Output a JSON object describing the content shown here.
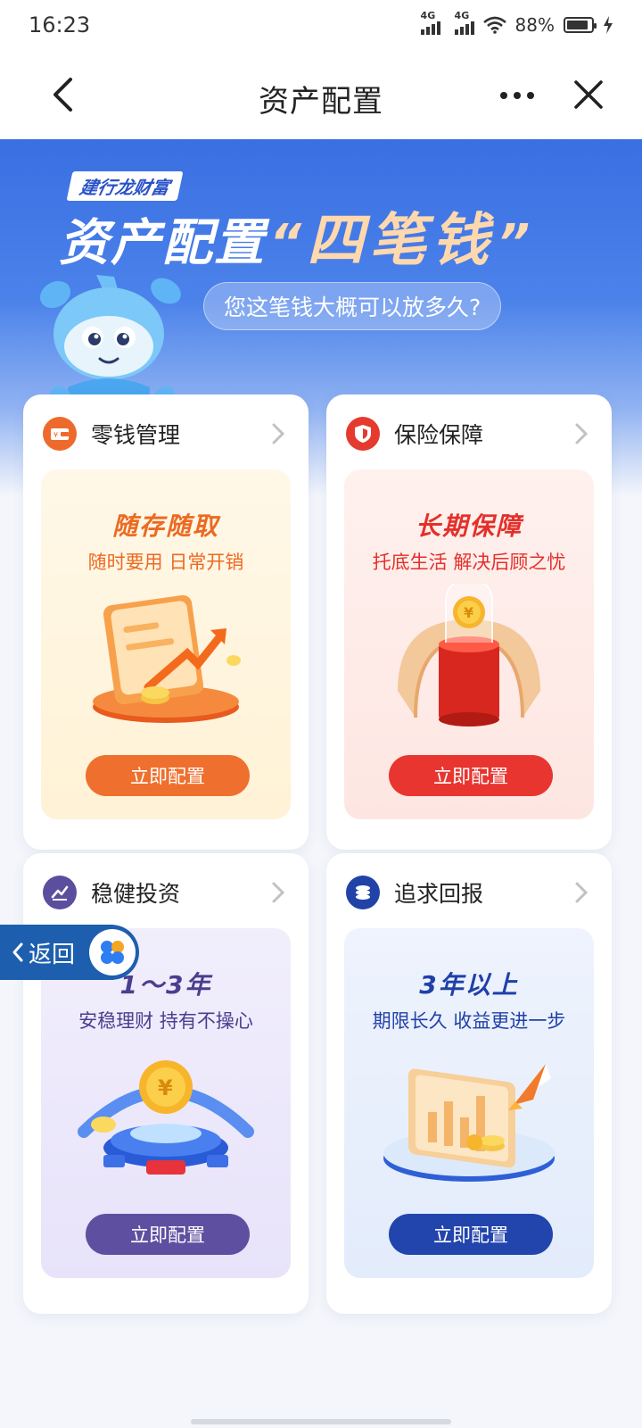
{
  "status_bar": {
    "time": "16:23",
    "signal_1_label": "4G",
    "signal_2_label": "4G",
    "battery_text": "88%",
    "battery_level": 0.88
  },
  "nav": {
    "title": "资产配置"
  },
  "banner": {
    "brand": "建行龙财富",
    "title_main": "资产配置",
    "quote_open": "“",
    "title_highlight": "四笔钱",
    "quote_close": "”",
    "bubble_text": "您这笔钱大概可以放多久?"
  },
  "cards": [
    {
      "label": "零钱管理",
      "heading": "随存随取",
      "subtitle": "随时要用 日常开销",
      "button": "立即配置",
      "icon": "wallet-icon",
      "colors": {
        "accent": "#ee6a2c",
        "heading": "#ec6a22",
        "body_top": "#fff8e8",
        "body_bottom": "#fff2d6",
        "button": "#ef6f2e"
      }
    },
    {
      "label": "保险保障",
      "heading": "长期保障",
      "subtitle": "托底生活 解决后顾之忧",
      "button": "立即配置",
      "icon": "shield-icon",
      "colors": {
        "accent": "#e53a2f",
        "heading": "#e4302a",
        "body_top": "#fff1ee",
        "body_bottom": "#fde6e2",
        "button": "#e8352f"
      }
    },
    {
      "label": "稳健投资",
      "heading": "1～3年",
      "subtitle": "安稳理财 持有不操心",
      "button": "立即配置",
      "icon": "trend-chart-icon",
      "colors": {
        "accent": "#5b4e9e",
        "heading": "#4a3e8e",
        "body_top": "#f1eefc",
        "body_bottom": "#e8e3fa",
        "button": "#5f4fa0"
      }
    },
    {
      "label": "追求回报",
      "heading": "3年以上",
      "subtitle": "期限长久 收益更进一步",
      "button": "立即配置",
      "icon": "coin-stack-icon",
      "colors": {
        "accent": "#2143a8",
        "heading": "#2040a8",
        "body_top": "#eef3fd",
        "body_bottom": "#e3ecfb",
        "button": "#2244ad"
      }
    }
  ],
  "float_back": {
    "label": "返回"
  }
}
